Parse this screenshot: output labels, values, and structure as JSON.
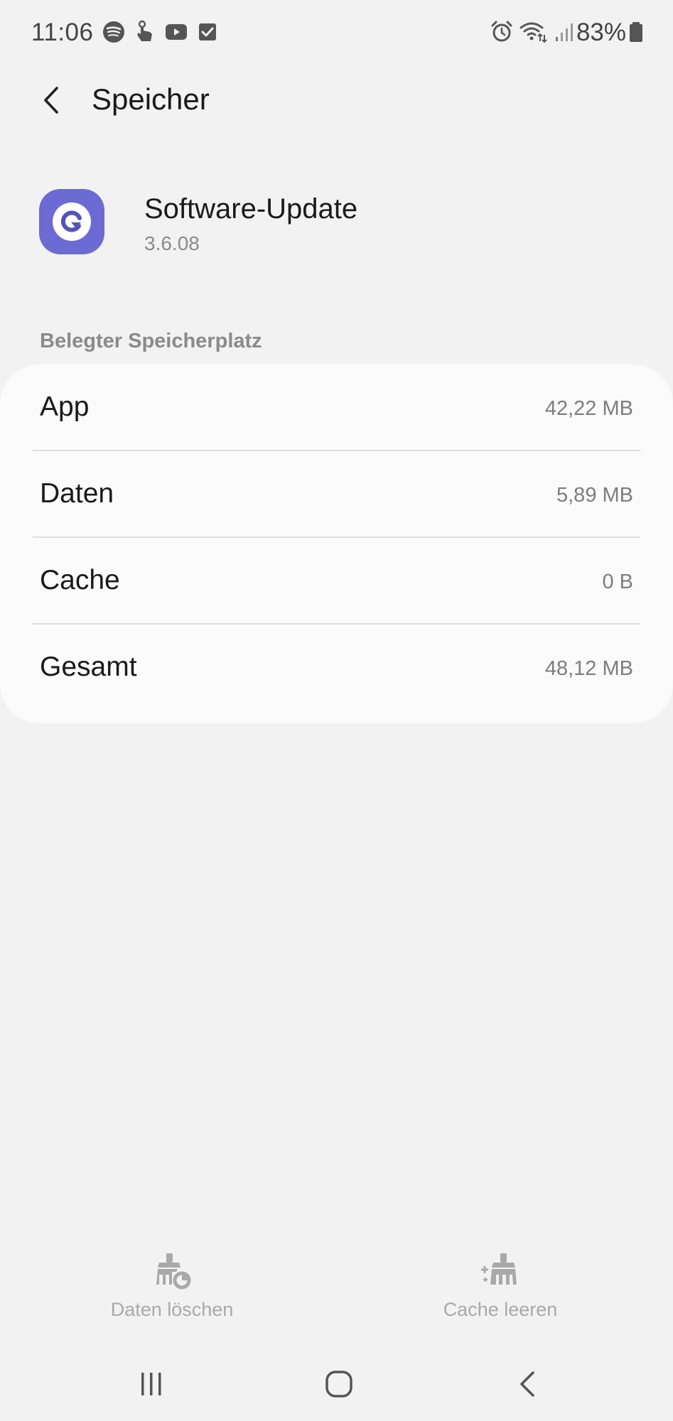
{
  "status_bar": {
    "time": "11:06",
    "battery": "83%",
    "left_icons": [
      "spotify-icon",
      "touch-gesture-icon",
      "youtube-icon",
      "checkbox-icon"
    ],
    "right_icons": [
      "alarm-icon",
      "wifi-icon",
      "signal-icon",
      "battery-icon"
    ]
  },
  "header": {
    "title": "Speicher"
  },
  "app": {
    "name": "Software-Update",
    "version": "3.6.08",
    "icon_color": "#6c6bd4"
  },
  "section": {
    "label": "Belegter Speicherplatz"
  },
  "storage_rows": [
    {
      "label": "App",
      "value": "42,22 MB"
    },
    {
      "label": "Daten",
      "value": "5,89 MB"
    },
    {
      "label": "Cache",
      "value": "0 B"
    },
    {
      "label": "Gesamt",
      "value": "48,12 MB"
    }
  ],
  "actions": {
    "clear_data": "Daten löschen",
    "clear_cache": "Cache leeren"
  },
  "colors": {
    "background": "#f2f2f2",
    "card": "#fbfbfb",
    "secondary_text": "#8a8a8a",
    "disabled": "#a9a9a9"
  }
}
